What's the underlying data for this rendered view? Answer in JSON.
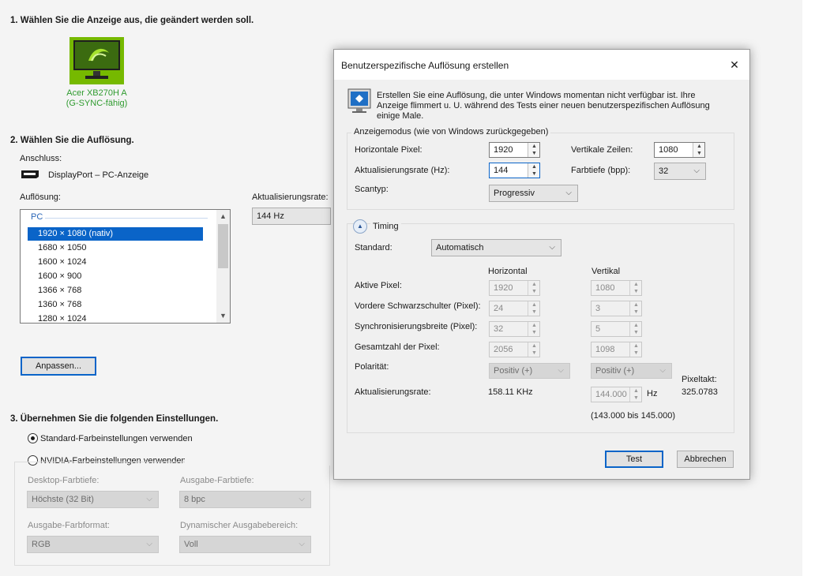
{
  "main": {
    "step1_heading": "1. Wählen Sie die Anzeige aus, die geändert werden soll.",
    "display_name_line1": "Acer XB270H A",
    "display_name_line2": "(G-SYNC-fähig)",
    "step2_heading": "2. Wählen Sie die Auflösung.",
    "connection_label": "Anschluss:",
    "connection_value": "DisplayPort – PC-Anzeige",
    "resolution_label": "Auflösung:",
    "refresh_label": "Aktualisierungsrate:",
    "refresh_value": "144 Hz",
    "list_group": "PC",
    "resolutions": [
      "1920 × 1080 (nativ)",
      "1680 × 1050",
      "1600 × 1024",
      "1600 × 900",
      "1366 × 768",
      "1360 × 768",
      "1280 × 1024"
    ],
    "customize_button": "Anpassen...",
    "step3_heading": "3. Übernehmen Sie die folgenden Einstellungen.",
    "radio_standard": "Standard-Farbeinstellungen verwenden",
    "radio_nvidia": "NVIDIA-Farbeinstellungen verwenden",
    "desktop_depth_label": "Desktop-Farbtiefe:",
    "desktop_depth_value": "Höchste (32 Bit)",
    "output_depth_label": "Ausgabe-Farbtiefe:",
    "output_depth_value": "8 bpc",
    "output_format_label": "Ausgabe-Farbformat:",
    "output_format_value": "RGB",
    "dynamic_range_label": "Dynamischer Ausgabebereich:",
    "dynamic_range_value": "Voll"
  },
  "dialog": {
    "title": "Benutzerspezifische Auflösung erstellen",
    "close_glyph": "✕",
    "info_text_line1": "Erstellen Sie eine Auflösung, die unter Windows momentan nicht verfügbar ist. Ihre",
    "info_text_line2": "Anzeige flimmert u. U. während des Tests einer neuen benutzerspezifischen Auflösung",
    "info_text_line3": "einige Male.",
    "mode_group": "Anzeigemodus (wie von Windows zurückgegeben)",
    "h_pixels_label": "Horizontale Pixel:",
    "h_pixels_value": "1920",
    "v_lines_label": "Vertikale Zeilen:",
    "v_lines_value": "1080",
    "refresh_label": "Aktualisierungsrate (Hz):",
    "refresh_value": "144",
    "color_depth_label": "Farbtiefe (bpp):",
    "color_depth_value": "32",
    "scan_label": "Scantyp:",
    "scan_value": "Progressiv",
    "timing_label": "Timing",
    "standard_label": "Standard:",
    "standard_value": "Automatisch",
    "col_horizontal": "Horizontal",
    "col_vertical": "Vertikal",
    "active_label": "Aktive Pixel:",
    "active_h": "1920",
    "active_v": "1080",
    "front_porch_label": "Vordere Schwarzschulter (Pixel):",
    "front_h": "24",
    "front_v": "3",
    "sync_width_label": "Synchronisierungsbreite (Pixel):",
    "sync_h": "32",
    "sync_v": "5",
    "total_label": "Gesamtzahl der Pixel:",
    "total_h": "2056",
    "total_v": "1098",
    "polarity_label": "Polarität:",
    "polarity_h": "Positiv (+)",
    "polarity_v": "Positiv (+)",
    "refresh2_label": "Aktualisierungsrate:",
    "refresh_khz": "158.11 KHz",
    "refresh_hz_value": "144.000",
    "hz_unit": "Hz",
    "pixelclock_label": "Pixeltakt:",
    "pixelclock_value": "325.0783",
    "range_text": "(143.000 bis 145.000)",
    "test_button": "Test",
    "cancel_button": "Abbrechen"
  },
  "colors": {
    "accent": "#0a64c8",
    "nvidia_green": "#76b900",
    "label_green": "#2f9b2f"
  }
}
